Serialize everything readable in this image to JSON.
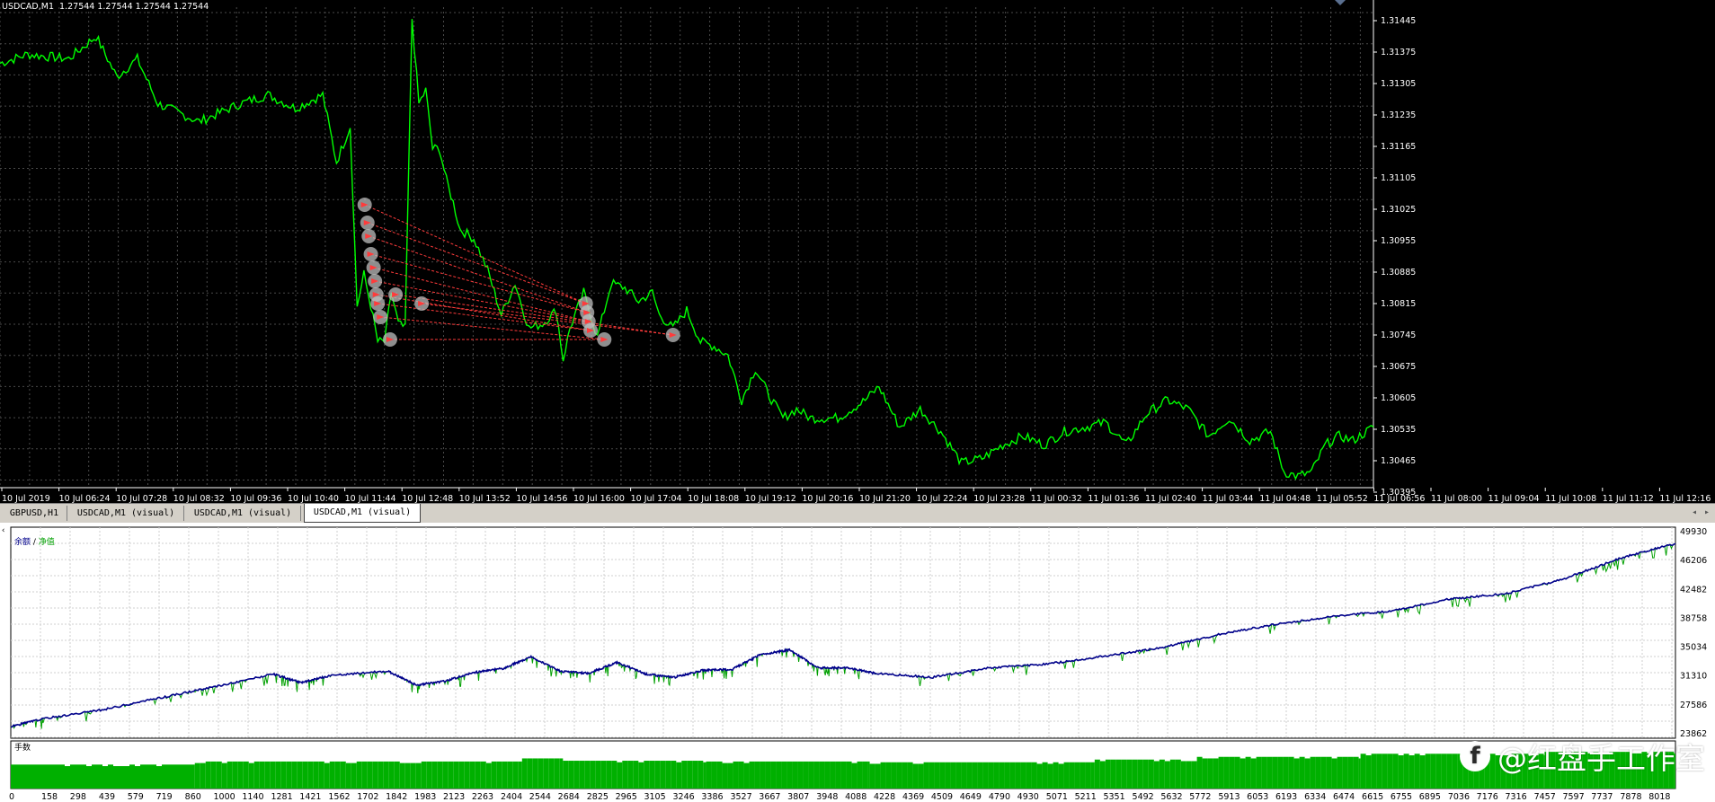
{
  "header": {
    "symbol_info": "USDCAD,M1  1.27544 1.27544 1.27544 1.27544"
  },
  "colors": {
    "background": "#000000",
    "grid": "#4a4a4a",
    "price_line": "#00ff00",
    "trade_marker": "#ff3b3b",
    "balance_line": "#00008b",
    "equity_line": "#00a000",
    "volume_bars": "#00b000"
  },
  "price_axis": {
    "labels": [
      "1.31445",
      "1.31375",
      "1.31305",
      "1.31235",
      "1.31165",
      "1.31105",
      "1.31025",
      "1.30955",
      "1.30885",
      "1.30815",
      "1.30745",
      "1.30675",
      "1.30605",
      "1.30535",
      "1.30465",
      "1.30395"
    ]
  },
  "time_axis": {
    "labels": [
      "10 Jul 2019",
      "10 Jul 06:24",
      "10 Jul 07:28",
      "10 Jul 08:32",
      "10 Jul 09:36",
      "10 Jul 10:40",
      "10 Jul 11:44",
      "10 Jul 12:48",
      "10 Jul 13:52",
      "10 Jul 14:56",
      "10 Jul 16:00",
      "10 Jul 17:04",
      "10 Jul 18:08",
      "10 Jul 19:12",
      "10 Jul 20:16",
      "10 Jul 21:20",
      "10 Jul 22:24",
      "10 Jul 23:28",
      "11 Jul 00:32",
      "11 Jul 01:36",
      "11 Jul 02:40",
      "11 Jul 03:44",
      "11 Jul 04:48",
      "11 Jul 05:52",
      "11 Jul 06:56",
      "11 Jul 08:00",
      "11 Jul 09:04",
      "11 Jul 10:08",
      "11 Jul 11:12",
      "11 Jul 12:16"
    ]
  },
  "price_chart": {
    "type": "line",
    "series": [
      {
        "x_index": [
          0,
          0.02,
          0.05,
          0.07,
          0.085,
          0.1,
          0.115,
          0.13,
          0.145,
          0.16,
          0.175,
          0.195,
          0.215,
          0.235,
          0.245,
          0.255,
          0.26,
          0.265,
          0.27,
          0.275,
          0.28,
          0.285,
          0.29,
          0.295,
          0.3,
          0.305,
          0.31,
          0.315,
          0.32,
          0.325,
          0.33,
          0.335,
          0.345,
          0.355,
          0.365,
          0.375,
          0.385,
          0.395,
          0.405,
          0.41,
          0.415,
          0.425,
          0.435,
          0.44,
          0.445,
          0.455,
          0.465,
          0.475,
          0.48,
          0.49,
          0.5,
          0.51,
          0.52,
          0.53,
          0.54,
          0.55,
          0.56,
          0.57,
          0.58,
          0.59,
          0.6,
          0.61,
          0.62,
          0.63,
          0.64,
          0.655,
          0.67,
          0.685,
          0.7,
          0.715,
          0.73,
          0.745,
          0.76,
          0.775,
          0.79,
          0.805,
          0.82,
          0.835,
          0.85,
          0.865,
          0.88,
          0.895,
          0.91,
          0.925,
          0.935,
          0.945,
          0.955,
          0.965,
          0.975,
          0.985,
          1.0
        ],
        "y": [
          1.3134,
          1.3136,
          1.3135,
          1.314,
          1.3131,
          1.3135,
          1.3125,
          1.3123,
          1.3121,
          1.3123,
          1.3125,
          1.3127,
          1.3124,
          1.3127,
          1.3112,
          1.312,
          1.308,
          1.3087,
          1.308,
          1.3072,
          1.3072,
          1.3083,
          1.3076,
          1.3075,
          1.3144,
          1.3125,
          1.3128,
          1.3115,
          1.3115,
          1.3108,
          1.3103,
          1.3097,
          1.3095,
          1.3088,
          1.3078,
          1.3085,
          1.3075,
          1.3076,
          1.3079,
          1.3068,
          1.3075,
          1.3083,
          1.3073,
          1.3079,
          1.3085,
          1.3084,
          1.3081,
          1.3083,
          1.3078,
          1.3075,
          1.3079,
          1.3072,
          1.3071,
          1.3069,
          1.3059,
          1.3066,
          1.306,
          1.3055,
          1.3057,
          1.3055,
          1.3055,
          1.3055,
          1.3057,
          1.3059,
          1.3062,
          1.3053,
          1.3057,
          1.3052,
          1.3045,
          1.3046,
          1.3049,
          1.3051,
          1.3049,
          1.3052,
          1.3053,
          1.3054,
          1.3049,
          1.3056,
          1.3059,
          1.3057,
          1.3051,
          1.3055,
          1.305,
          1.3052,
          1.3043,
          1.3042,
          1.3043,
          1.3049,
          1.3051,
          1.305,
          1.3053
        ]
      }
    ],
    "ylim": [
      1.30395,
      1.31465
    ]
  },
  "trades": {
    "entries": [
      {
        "x": 0.2655,
        "y": 1.31025
      },
      {
        "x": 0.2675,
        "y": 1.30985
      },
      {
        "x": 0.2685,
        "y": 1.30955
      },
      {
        "x": 0.27,
        "y": 1.30915
      },
      {
        "x": 0.272,
        "y": 1.30885
      },
      {
        "x": 0.273,
        "y": 1.30855
      },
      {
        "x": 0.274,
        "y": 1.30825
      },
      {
        "x": 0.275,
        "y": 1.30805
      },
      {
        "x": 0.277,
        "y": 1.30775
      },
      {
        "x": 0.284,
        "y": 1.30725
      },
      {
        "x": 0.288,
        "y": 1.30825
      },
      {
        "x": 0.307,
        "y": 1.30805
      }
    ],
    "exits": [
      {
        "x": 0.4265,
        "y": 1.30805
      },
      {
        "x": 0.4275,
        "y": 1.30785
      },
      {
        "x": 0.4285,
        "y": 1.30765
      },
      {
        "x": 0.43,
        "y": 1.30745
      },
      {
        "x": 0.44,
        "y": 1.30725
      },
      {
        "x": 0.49,
        "y": 1.30735
      }
    ]
  },
  "tabs": [
    {
      "label": "GBPUSD,H1",
      "active": false
    },
    {
      "label": "USDCAD,M1 (visual)",
      "active": false
    },
    {
      "label": "USDCAD,M1 (visual)",
      "active": false
    },
    {
      "label": "USDCAD,M1 (visual)",
      "active": true
    }
  ],
  "report": {
    "legend_balance": "余额",
    "legend_sep": " / ",
    "legend_equity": "净值",
    "volume_title": "手数",
    "balance_axis": {
      "labels": [
        "49930",
        "46206",
        "42482",
        "38758",
        "35034",
        "31310",
        "27586",
        "23862"
      ]
    },
    "trade_axis": {
      "labels": [
        "0",
        "158",
        "298",
        "439",
        "579",
        "719",
        "860",
        "1000",
        "1140",
        "1281",
        "1421",
        "1562",
        "1702",
        "1842",
        "1983",
        "2123",
        "2263",
        "2404",
        "2544",
        "2684",
        "2825",
        "2965",
        "3105",
        "3246",
        "3386",
        "3527",
        "3667",
        "3807",
        "3948",
        "4088",
        "4228",
        "4369",
        "4509",
        "4649",
        "4790",
        "4930",
        "5071",
        "5211",
        "5351",
        "5492",
        "5632",
        "5772",
        "5913",
        "6053",
        "6193",
        "6334",
        "6474",
        "6615",
        "6755",
        "6895",
        "7036",
        "7176",
        "7316",
        "7457",
        "7597",
        "7737",
        "7878",
        "8018"
      ]
    }
  },
  "balance_chart": {
    "type": "line",
    "ylim": [
      23862,
      49930
    ],
    "series": [
      {
        "name": "余额",
        "x": [
          0,
          158,
          439,
          719,
          1000,
          1281,
          1421,
          1562,
          1842,
          1983,
          2123,
          2263,
          2404,
          2544,
          2684,
          2825,
          2965,
          3105,
          3246,
          3386,
          3527,
          3667,
          3807,
          3948,
          4088,
          4228,
          4509,
          4790,
          5071,
          5351,
          5632,
          5913,
          6193,
          6474,
          6755,
          7036,
          7316,
          7597,
          7878,
          8140
        ],
        "y": [
          24900,
          25900,
          27000,
          28500,
          30000,
          31600,
          30500,
          31400,
          32000,
          30200,
          30700,
          31800,
          32300,
          33800,
          32000,
          31700,
          33100,
          31600,
          31200,
          32100,
          32200,
          34100,
          34700,
          32400,
          32400,
          31700,
          31200,
          32400,
          32900,
          33900,
          35000,
          36700,
          38000,
          39000,
          39700,
          41200,
          41900,
          43800,
          46500,
          48300
        ]
      }
    ]
  },
  "volume_chart": {
    "type": "bar",
    "steps": [
      {
        "from": 0,
        "to": 900,
        "v": 0.62
      },
      {
        "from": 900,
        "to": 2500,
        "v": 0.7
      },
      {
        "from": 2500,
        "to": 2700,
        "v": 0.78
      },
      {
        "from": 2700,
        "to": 3400,
        "v": 0.72
      },
      {
        "from": 3400,
        "to": 4200,
        "v": 0.7
      },
      {
        "from": 4200,
        "to": 5300,
        "v": 0.68
      },
      {
        "from": 5300,
        "to": 5800,
        "v": 0.75
      },
      {
        "from": 5800,
        "to": 6600,
        "v": 0.82
      },
      {
        "from": 6600,
        "to": 7500,
        "v": 0.9
      },
      {
        "from": 7500,
        "to": 8140,
        "v": 0.95
      }
    ]
  },
  "watermark": {
    "logo_glyph": "f",
    "text": "@红盘手工作室"
  }
}
